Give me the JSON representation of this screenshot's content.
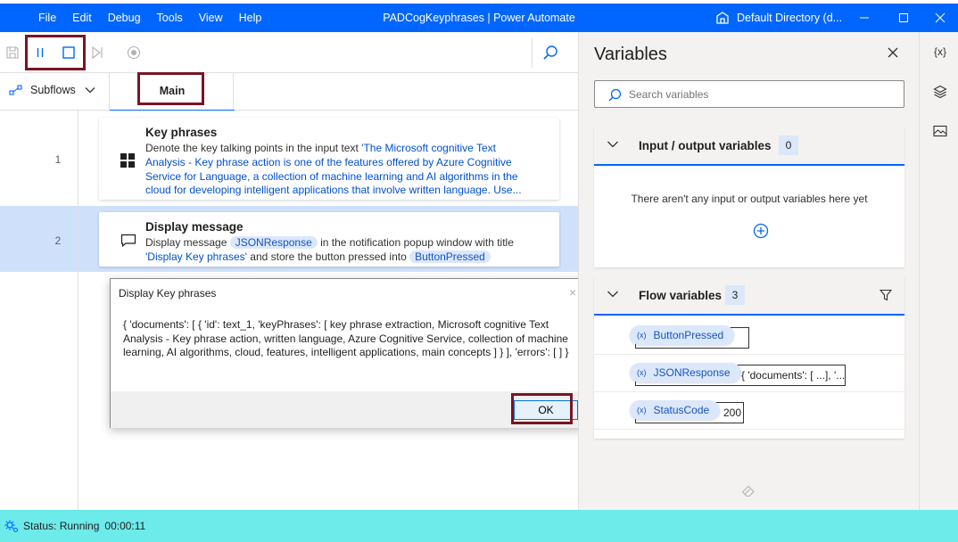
{
  "titlebar": {
    "menu": [
      "File",
      "Edit",
      "Debug",
      "Tools",
      "View",
      "Help"
    ],
    "title": "PADCogKeyphrases | Power Automate",
    "directory": "Default Directory (d..."
  },
  "tabs": {
    "subflows_label": "Subflows",
    "main_label": "Main"
  },
  "actions": [
    {
      "line": "1",
      "title": "Key phrases",
      "desc_prefix": "Denote the key talking points in the input text ",
      "desc_link": "'The Microsoft cognitive Text Analysis - Key phrase action is one of the features offered by Azure Cognitive Service for Language, a collection of machine learning and AI algorithms in the cloud for developing intelligent applications that involve written language. Use..."
    },
    {
      "line": "2",
      "title": "Display message",
      "desc_1": "Display message ",
      "var_1": "JSONResponse",
      "desc_2": " in the notification popup window with title ",
      "link": "'Display Key phrases'",
      "desc_3": " and store the button pressed into ",
      "var_2": "ButtonPressed"
    }
  ],
  "dialog": {
    "title": "Display Key phrases",
    "close": "×",
    "message": "{ 'documents': [ { 'id': text_1, 'keyPhrases': [ key phrase extraction, Microsoft cognitive Text Analysis - Key phrase action, written language, Azure Cognitive Service, collection of machine learning, AI algorithms, cloud, features, intelligent applications, main concepts ] } ], 'errors': [  ] }",
    "ok_label": "OK"
  },
  "variables": {
    "title": "Variables",
    "search_placeholder": "Search variables",
    "io_section": {
      "title": "Input / output variables",
      "count": "0",
      "empty_message": "There aren't any input or output variables here yet"
    },
    "flow_section": {
      "title": "Flow variables",
      "count": "3",
      "items": [
        {
          "icon": "(x)",
          "name": "ButtonPressed",
          "value": ""
        },
        {
          "icon": "(x)",
          "name": "JSONResponse",
          "value": "{ 'documents': [ ...], '..."
        },
        {
          "icon": "(x)",
          "name": "StatusCode",
          "value": "200"
        }
      ]
    }
  },
  "rail": {
    "variables_icon_text": "{x}"
  },
  "status": {
    "text": "Status: Running",
    "time": "00:00:11"
  },
  "colors": {
    "titlebar": "#0066ff",
    "statusbar": "#6deaea",
    "highlight": "#7a1424",
    "selected_row": "#cfe0fb"
  },
  "icons": [
    "save-icon",
    "pause-icon",
    "stop-icon",
    "step-icon",
    "record-icon",
    "search-icon",
    "subflows-icon",
    "chevron-down-icon",
    "windows-logo-icon",
    "message-icon",
    "close-icon",
    "filter-icon",
    "add-icon",
    "eraser-icon",
    "layers-icon",
    "image-icon",
    "status-gear-icon",
    "directory-icon"
  ]
}
